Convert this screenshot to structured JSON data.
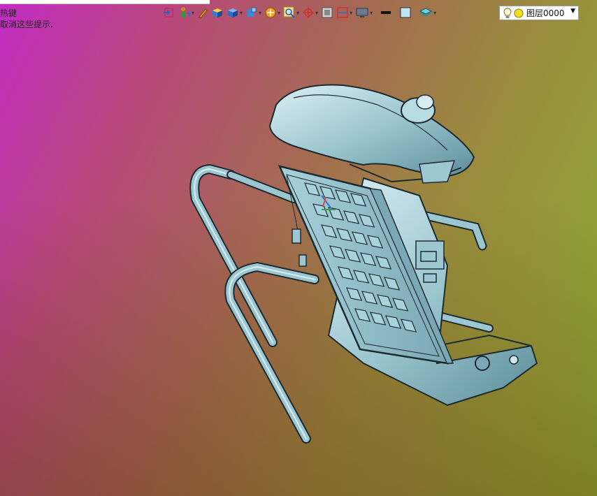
{
  "hints": {
    "line1": "热键",
    "line2": "取消这些提示."
  },
  "toolbar": {
    "icons": [
      "exit-sketch-icon",
      "person-rotate-icon",
      "pen-icon",
      "shaded-box-icon",
      "blue-cube-icon",
      "section-cube-icon",
      "orange-circle-icon",
      "magnifier-icon",
      "axis-target-icon",
      "grid-view-icon",
      "red-frame-icon",
      "monitor-icon",
      "line-weight-icon",
      "color-swatch-icon",
      "layer-stack-icon"
    ],
    "layer_label": "图层0000"
  },
  "colors": {
    "model_fill": "#9cc6d0",
    "model_edge": "#1d2a30",
    "background_start": "#c22cc4",
    "background_end": "#8fb034"
  }
}
